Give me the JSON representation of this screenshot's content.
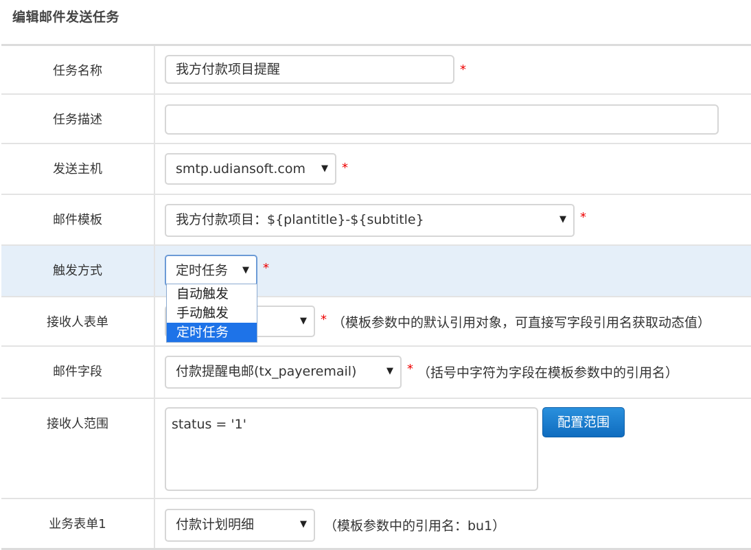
{
  "title": "编辑邮件发送任务",
  "fields": {
    "task_name": {
      "label": "任务名称",
      "value": "我方付款项目提醒",
      "required": "*"
    },
    "task_desc": {
      "label": "任务描述",
      "value": ""
    },
    "smtp_host": {
      "label": "发送主机",
      "value": "smtp.udiansoft.com",
      "required": "*"
    },
    "mail_template": {
      "label": "邮件模板",
      "value": "我方付款项目：${plantitle}-${subtitle}",
      "required": "*"
    },
    "trigger": {
      "label": "触发方式",
      "value": "定时任务",
      "required": "*",
      "options": [
        "自动触发",
        "手动触发",
        "定时任务"
      ]
    },
    "recipient_form": {
      "label": "接收人表单",
      "value": "",
      "required": "*",
      "hint": "（模板参数中的默认引用对象，可直接写字段引用名获取动态值）"
    },
    "mail_field": {
      "label": "邮件字段",
      "value": "付款提醒电邮(tx_payeremail)",
      "required": "*",
      "hint": "（括号中字符为字段在模板参数中的引用名）"
    },
    "recipient_scope": {
      "label": "接收人范围",
      "value": "status = '1'",
      "button": "配置范围"
    },
    "biz_form1": {
      "label": "业务表单1",
      "value": "付款计划明细",
      "hint": "（模板参数中的引用名：bu1）"
    }
  },
  "icons": {
    "select_arrow": "▼"
  },
  "colors": {
    "accent": "#1e73e8",
    "required": "#e00000",
    "highlight_row": "#e5eff9"
  }
}
